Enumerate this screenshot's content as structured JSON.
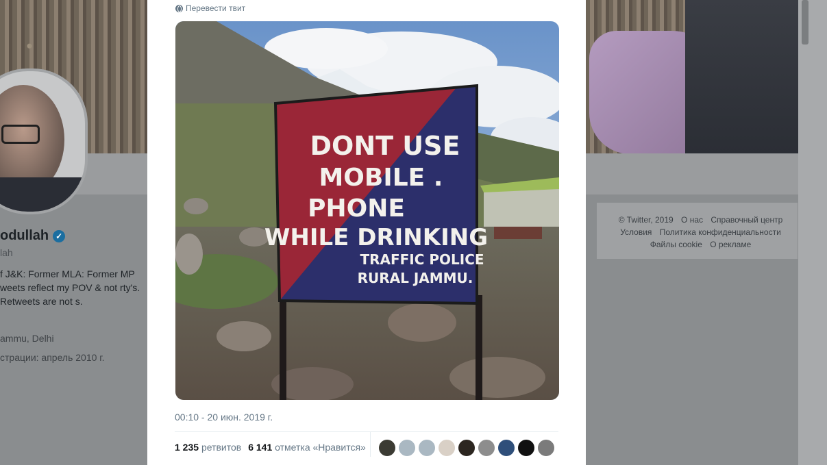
{
  "profile": {
    "name": "odullah",
    "handle": "lah",
    "bio": "f J&K: Former MLA: Former MP weets reflect my POV & not rty's. Retweets are not s.",
    "location": "ammu, Delhi",
    "joined": "страции: апрель 2010 г."
  },
  "footer": {
    "links": [
      "© Twitter, 2019",
      "О нас",
      "Справочный центр",
      "Условия",
      "Политика конфиденциальности",
      "Файлы cookie",
      "О рекламе"
    ]
  },
  "tweet": {
    "translate_label": "Перевести твит",
    "sign": {
      "line1": "DONT USE",
      "line2": "MOBILE .",
      "line3": "PHONE",
      "line4": "WHILE DRINKING",
      "line5": "TRAFFIC POLICE",
      "line6": "RURAL JAMMU."
    },
    "timestamp": "00:10 - 20 июн. 2019 г.",
    "retweets_count": "1 235",
    "retweets_label": "ретвитов",
    "likes_count": "6 141",
    "likes_label": "отметка «Нравится»"
  },
  "likers": [
    {
      "icon": "avatar-dark-icon",
      "color": "#3b3b33"
    },
    {
      "icon": "default-avatar-icon",
      "color": "#aab8c2"
    },
    {
      "icon": "default-avatar-icon",
      "color": "#aab8c2"
    },
    {
      "icon": "avatar-light-icon",
      "color": "#d9d0c6"
    },
    {
      "icon": "avatar-dark-icon",
      "color": "#2c2620"
    },
    {
      "icon": "avatar-grey-icon",
      "color": "#8d8d8d"
    },
    {
      "icon": "avatar-blue-icon",
      "color": "#2f4f7a"
    },
    {
      "icon": "avatar-black-icon",
      "color": "#111111"
    },
    {
      "icon": "avatar-grey-icon",
      "color": "#7b7b7b"
    }
  ]
}
